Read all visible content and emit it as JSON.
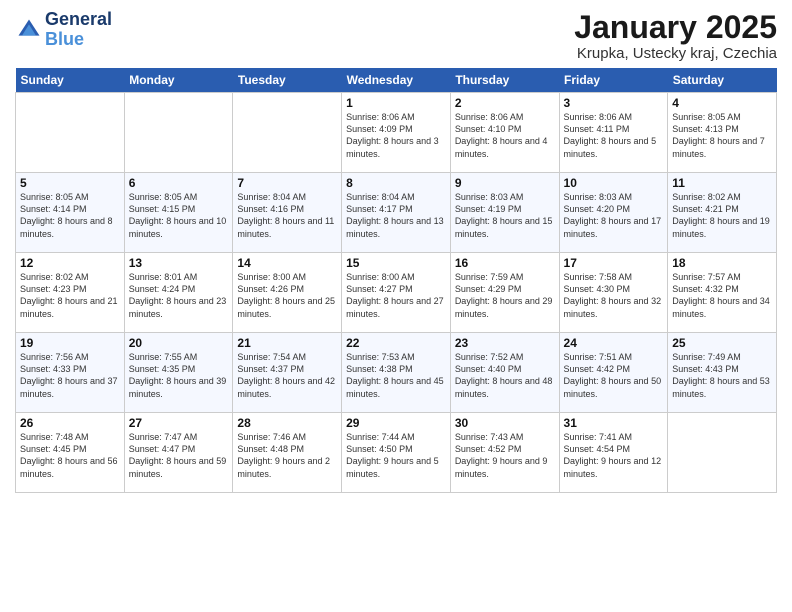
{
  "header": {
    "logo_line1": "General",
    "logo_line2": "Blue",
    "title": "January 2025",
    "subtitle": "Krupka, Ustecky kraj, Czechia"
  },
  "weekdays": [
    "Sunday",
    "Monday",
    "Tuesday",
    "Wednesday",
    "Thursday",
    "Friday",
    "Saturday"
  ],
  "weeks": [
    [
      {
        "day": "",
        "info": ""
      },
      {
        "day": "",
        "info": ""
      },
      {
        "day": "",
        "info": ""
      },
      {
        "day": "1",
        "info": "Sunrise: 8:06 AM\nSunset: 4:09 PM\nDaylight: 8 hours and 3 minutes."
      },
      {
        "day": "2",
        "info": "Sunrise: 8:06 AM\nSunset: 4:10 PM\nDaylight: 8 hours and 4 minutes."
      },
      {
        "day": "3",
        "info": "Sunrise: 8:06 AM\nSunset: 4:11 PM\nDaylight: 8 hours and 5 minutes."
      },
      {
        "day": "4",
        "info": "Sunrise: 8:05 AM\nSunset: 4:13 PM\nDaylight: 8 hours and 7 minutes."
      }
    ],
    [
      {
        "day": "5",
        "info": "Sunrise: 8:05 AM\nSunset: 4:14 PM\nDaylight: 8 hours and 8 minutes."
      },
      {
        "day": "6",
        "info": "Sunrise: 8:05 AM\nSunset: 4:15 PM\nDaylight: 8 hours and 10 minutes."
      },
      {
        "day": "7",
        "info": "Sunrise: 8:04 AM\nSunset: 4:16 PM\nDaylight: 8 hours and 11 minutes."
      },
      {
        "day": "8",
        "info": "Sunrise: 8:04 AM\nSunset: 4:17 PM\nDaylight: 8 hours and 13 minutes."
      },
      {
        "day": "9",
        "info": "Sunrise: 8:03 AM\nSunset: 4:19 PM\nDaylight: 8 hours and 15 minutes."
      },
      {
        "day": "10",
        "info": "Sunrise: 8:03 AM\nSunset: 4:20 PM\nDaylight: 8 hours and 17 minutes."
      },
      {
        "day": "11",
        "info": "Sunrise: 8:02 AM\nSunset: 4:21 PM\nDaylight: 8 hours and 19 minutes."
      }
    ],
    [
      {
        "day": "12",
        "info": "Sunrise: 8:02 AM\nSunset: 4:23 PM\nDaylight: 8 hours and 21 minutes."
      },
      {
        "day": "13",
        "info": "Sunrise: 8:01 AM\nSunset: 4:24 PM\nDaylight: 8 hours and 23 minutes."
      },
      {
        "day": "14",
        "info": "Sunrise: 8:00 AM\nSunset: 4:26 PM\nDaylight: 8 hours and 25 minutes."
      },
      {
        "day": "15",
        "info": "Sunrise: 8:00 AM\nSunset: 4:27 PM\nDaylight: 8 hours and 27 minutes."
      },
      {
        "day": "16",
        "info": "Sunrise: 7:59 AM\nSunset: 4:29 PM\nDaylight: 8 hours and 29 minutes."
      },
      {
        "day": "17",
        "info": "Sunrise: 7:58 AM\nSunset: 4:30 PM\nDaylight: 8 hours and 32 minutes."
      },
      {
        "day": "18",
        "info": "Sunrise: 7:57 AM\nSunset: 4:32 PM\nDaylight: 8 hours and 34 minutes."
      }
    ],
    [
      {
        "day": "19",
        "info": "Sunrise: 7:56 AM\nSunset: 4:33 PM\nDaylight: 8 hours and 37 minutes."
      },
      {
        "day": "20",
        "info": "Sunrise: 7:55 AM\nSunset: 4:35 PM\nDaylight: 8 hours and 39 minutes."
      },
      {
        "day": "21",
        "info": "Sunrise: 7:54 AM\nSunset: 4:37 PM\nDaylight: 8 hours and 42 minutes."
      },
      {
        "day": "22",
        "info": "Sunrise: 7:53 AM\nSunset: 4:38 PM\nDaylight: 8 hours and 45 minutes."
      },
      {
        "day": "23",
        "info": "Sunrise: 7:52 AM\nSunset: 4:40 PM\nDaylight: 8 hours and 48 minutes."
      },
      {
        "day": "24",
        "info": "Sunrise: 7:51 AM\nSunset: 4:42 PM\nDaylight: 8 hours and 50 minutes."
      },
      {
        "day": "25",
        "info": "Sunrise: 7:49 AM\nSunset: 4:43 PM\nDaylight: 8 hours and 53 minutes."
      }
    ],
    [
      {
        "day": "26",
        "info": "Sunrise: 7:48 AM\nSunset: 4:45 PM\nDaylight: 8 hours and 56 minutes."
      },
      {
        "day": "27",
        "info": "Sunrise: 7:47 AM\nSunset: 4:47 PM\nDaylight: 8 hours and 59 minutes."
      },
      {
        "day": "28",
        "info": "Sunrise: 7:46 AM\nSunset: 4:48 PM\nDaylight: 9 hours and 2 minutes."
      },
      {
        "day": "29",
        "info": "Sunrise: 7:44 AM\nSunset: 4:50 PM\nDaylight: 9 hours and 5 minutes."
      },
      {
        "day": "30",
        "info": "Sunrise: 7:43 AM\nSunset: 4:52 PM\nDaylight: 9 hours and 9 minutes."
      },
      {
        "day": "31",
        "info": "Sunrise: 7:41 AM\nSunset: 4:54 PM\nDaylight: 9 hours and 12 minutes."
      },
      {
        "day": "",
        "info": ""
      }
    ]
  ]
}
